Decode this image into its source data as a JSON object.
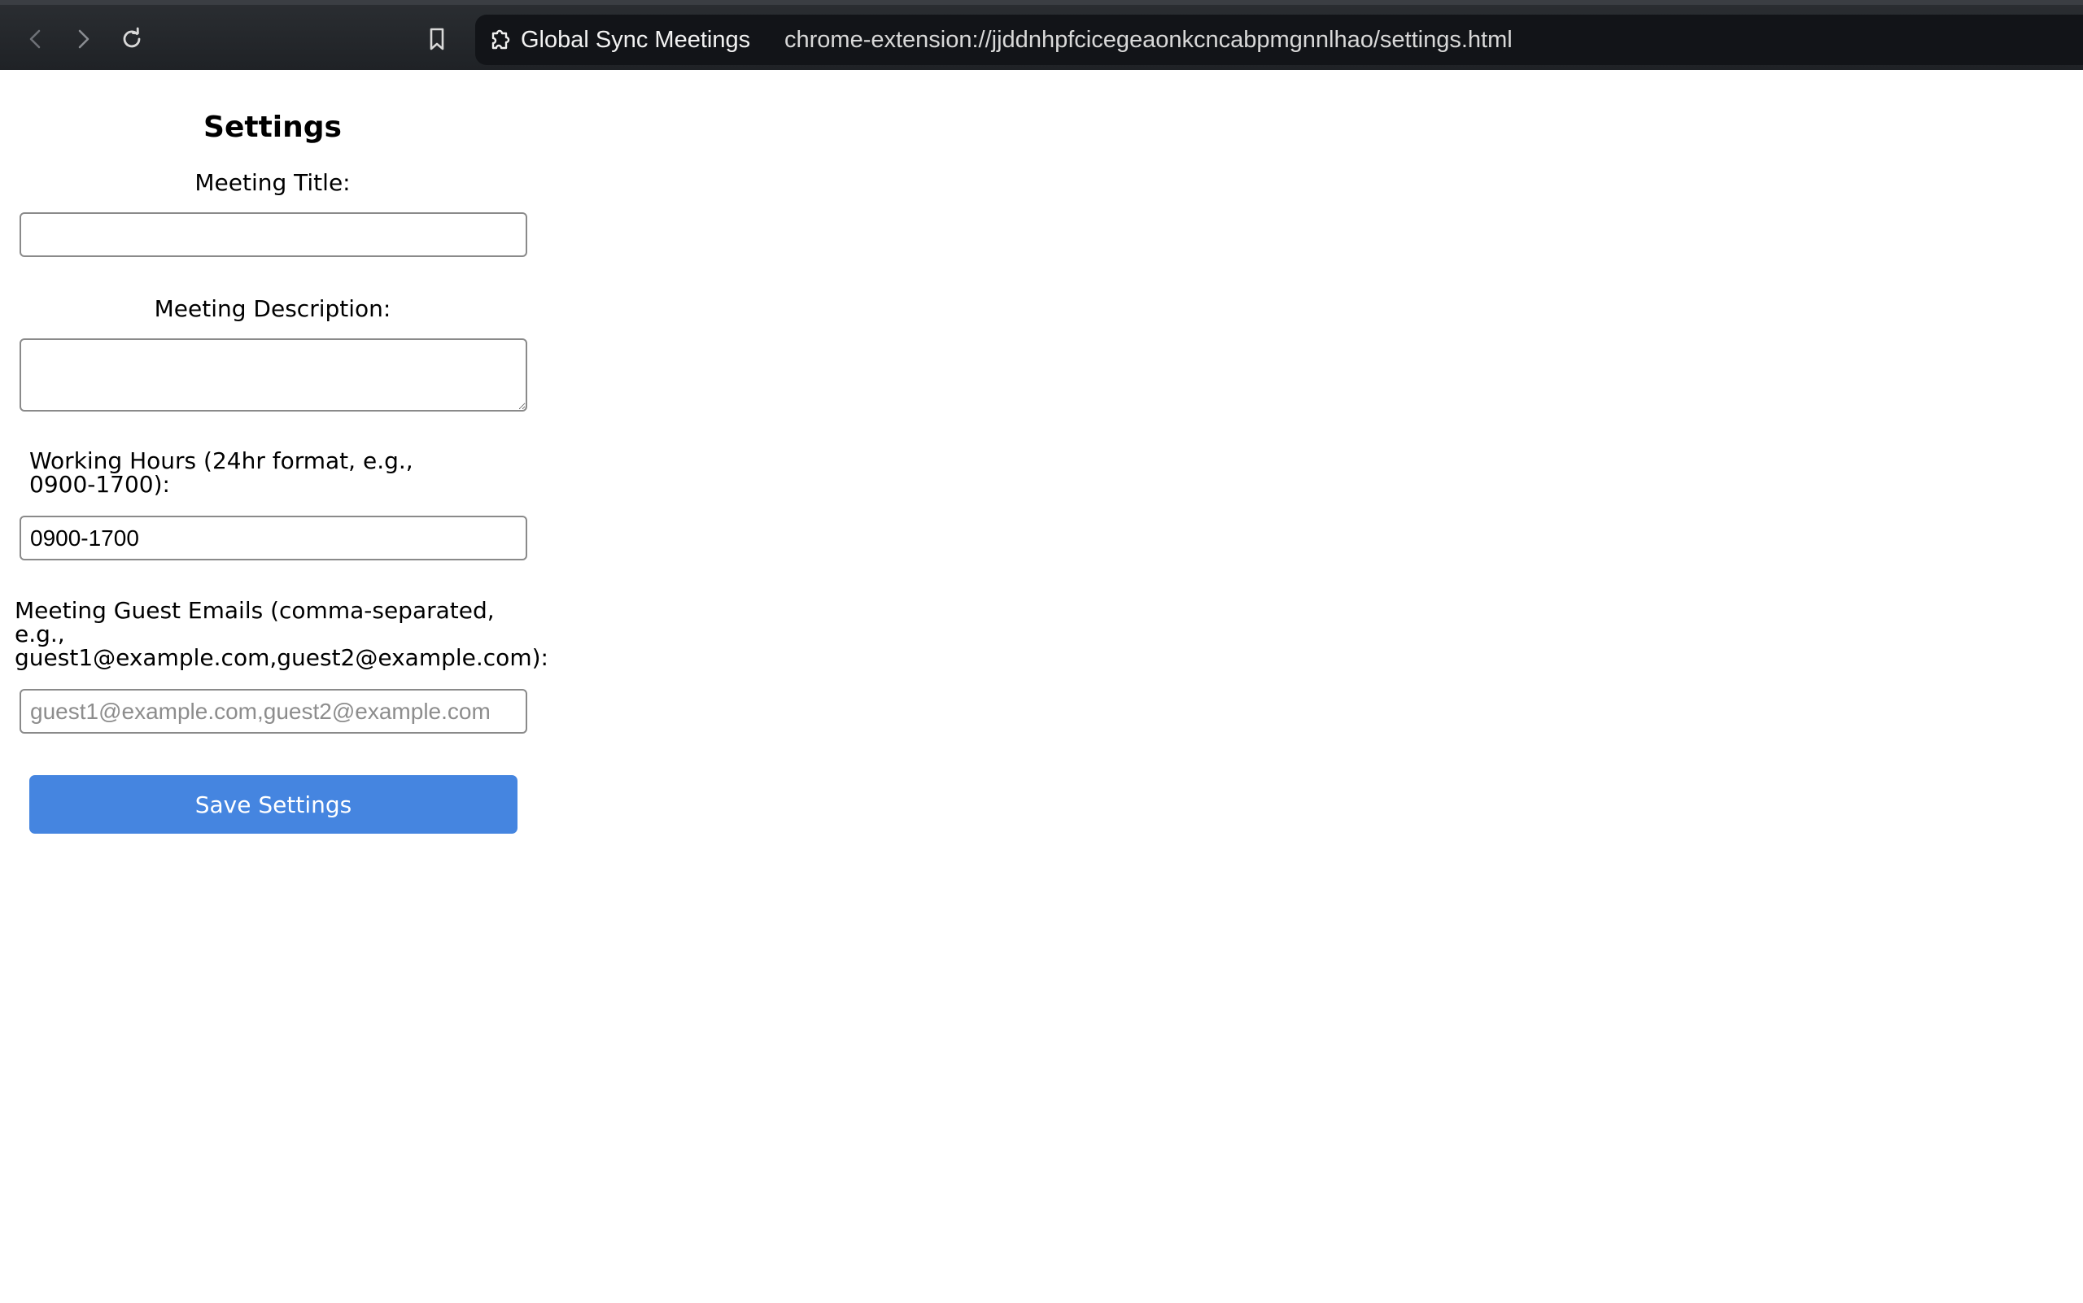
{
  "browser": {
    "site_name": "Global Sync Meetings",
    "url": "chrome-extension://jjddnhpfcicegeaonkcncabpmgnnlhao/settings.html",
    "icons": [
      "back-icon",
      "forward-icon",
      "reload-icon",
      "bookmark-icon",
      "extension-icon"
    ]
  },
  "settings": {
    "heading": "Settings",
    "meeting_title": {
      "label": "Meeting Title:",
      "value": ""
    },
    "meeting_description": {
      "label": "Meeting Description:",
      "value": ""
    },
    "working_hours": {
      "label": "Working Hours (24hr format, e.g., 0900-1700):",
      "value": "0900-1700"
    },
    "guest_emails": {
      "label": "Meeting Guest Emails (comma-separated, e.g., guest1@example.com,guest2@example.com):",
      "value": "",
      "placeholder": "guest1@example.com,guest2@example.com"
    },
    "save_label": "Save Settings"
  },
  "colors": {
    "toolbar_bg": "#24272b",
    "omnibox_bg": "#121418",
    "button_bg": "#4585e0"
  }
}
